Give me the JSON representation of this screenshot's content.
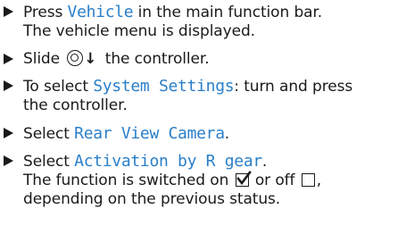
{
  "steps": [
    {
      "before": "Press ",
      "keyword": "Vehicle",
      "after": " in the main function bar.",
      "line2": "The vehicle menu is displayed."
    },
    {
      "before": "Slide ",
      "after": " the controller.",
      "symbol": "controller-slide-down"
    },
    {
      "before": "To select ",
      "keyword": "System Settings",
      "after": ": turn and press",
      "line2": "the controller."
    },
    {
      "before": "Select ",
      "keyword": "Rear View Camera",
      "after": "."
    },
    {
      "before": "Select ",
      "keyword": "Activation by R gear",
      "after": ".",
      "line2a": "The function is switched on ",
      "line2b": " or off ",
      "line2c": ",",
      "line3": "depending on the previous status."
    }
  ],
  "icons": {
    "bullet": "triangle-right-icon",
    "controller": "controller-icon",
    "checked": "checkbox-checked-icon",
    "unchecked": "checkbox-unchecked-icon"
  },
  "colors": {
    "text": "#1a1a1a",
    "keyword": "#2a7fc9"
  }
}
